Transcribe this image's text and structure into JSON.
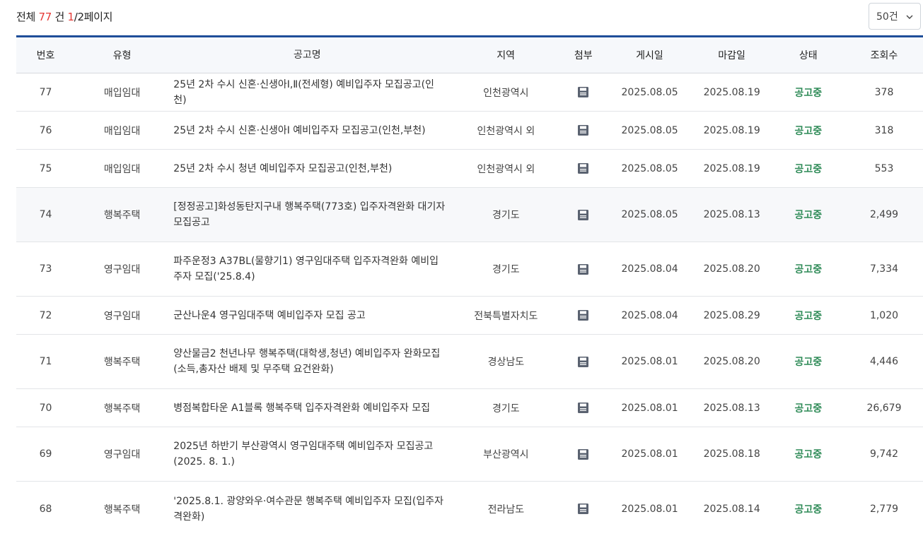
{
  "summary": {
    "total_prefix": "전체",
    "total_count": "77",
    "total_unit": "건",
    "page_current": "1",
    "page_rest": "/2페이지"
  },
  "page_size": {
    "selected": "50건",
    "icon": "chevron-down-icon"
  },
  "table": {
    "headers": {
      "no": "번호",
      "type": "유형",
      "title": "공고명",
      "region": "지역",
      "attach": "첨부",
      "posted": "게시일",
      "deadline": "마감일",
      "status": "상태",
      "views": "조회수"
    },
    "attach_icon": "file-save-icon",
    "colors": {
      "header_border": "#1f4e99",
      "status": "#2e8b57",
      "count": "#e53935"
    },
    "rows": [
      {
        "no": "77",
        "type": "매입임대",
        "title": "25년 2차 수시 신혼·신생아Ⅰ,Ⅱ(전세형) 예비입주자 모집공고(인천)",
        "region": "인천광역시",
        "posted": "2025.08.05",
        "deadline": "2025.08.19",
        "status": "공고중",
        "views": "378"
      },
      {
        "no": "76",
        "type": "매입임대",
        "title": "25년 2차 수시 신혼·신생아Ⅰ 예비입주자 모집공고(인천,부천)",
        "region": "인천광역시 외",
        "posted": "2025.08.05",
        "deadline": "2025.08.19",
        "status": "공고중",
        "views": "318"
      },
      {
        "no": "75",
        "type": "매입임대",
        "title": "25년 2차 수시 청년 예비입주자 모집공고(인천,부천)",
        "region": "인천광역시 외",
        "posted": "2025.08.05",
        "deadline": "2025.08.19",
        "status": "공고중",
        "views": "553"
      },
      {
        "no": "74",
        "type": "행복주택",
        "title": "[정정공고]화성동탄지구내 행복주택(773호) 입주자격완화 대기자 모집공고",
        "region": "경기도",
        "posted": "2025.08.05",
        "deadline": "2025.08.13",
        "status": "공고중",
        "views": "2,499"
      },
      {
        "no": "73",
        "type": "영구임대",
        "title": "파주운정3 A37BL(물향기1) 영구임대주택 입주자격완화 예비입주자 모집('25.8.4)",
        "region": "경기도",
        "posted": "2025.08.04",
        "deadline": "2025.08.20",
        "status": "공고중",
        "views": "7,334"
      },
      {
        "no": "72",
        "type": "영구임대",
        "title": "군산나운4 영구임대주택 예비입주자 모집 공고",
        "region": "전북특별자치도",
        "posted": "2025.08.04",
        "deadline": "2025.08.29",
        "status": "공고중",
        "views": "1,020"
      },
      {
        "no": "71",
        "type": "행복주택",
        "title": "양산물금2 천년나무 행복주택(대학생,청년) 예비입주자 완화모집(소득,총자산 배제 및 무주택 요건완화)",
        "region": "경상남도",
        "posted": "2025.08.01",
        "deadline": "2025.08.20",
        "status": "공고중",
        "views": "4,446"
      },
      {
        "no": "70",
        "type": "행복주택",
        "title": "병점복합타운 A1블록 행복주택 입주자격완화 예비입주자 모집",
        "region": "경기도",
        "posted": "2025.08.01",
        "deadline": "2025.08.13",
        "status": "공고중",
        "views": "26,679"
      },
      {
        "no": "69",
        "type": "영구임대",
        "title": "2025년 하반기 부산광역시 영구임대주택 예비입주자 모집공고(2025. 8. 1.)",
        "region": "부산광역시",
        "posted": "2025.08.01",
        "deadline": "2025.08.18",
        "status": "공고중",
        "views": "9,742"
      },
      {
        "no": "68",
        "type": "행복주택",
        "title": "'2025.8.1. 광양와우·여수관문 행복주택 예비입주자 모집(입주자격완화)",
        "region": "전라남도",
        "posted": "2025.08.01",
        "deadline": "2025.08.14",
        "status": "공고중",
        "views": "2,779"
      }
    ]
  }
}
